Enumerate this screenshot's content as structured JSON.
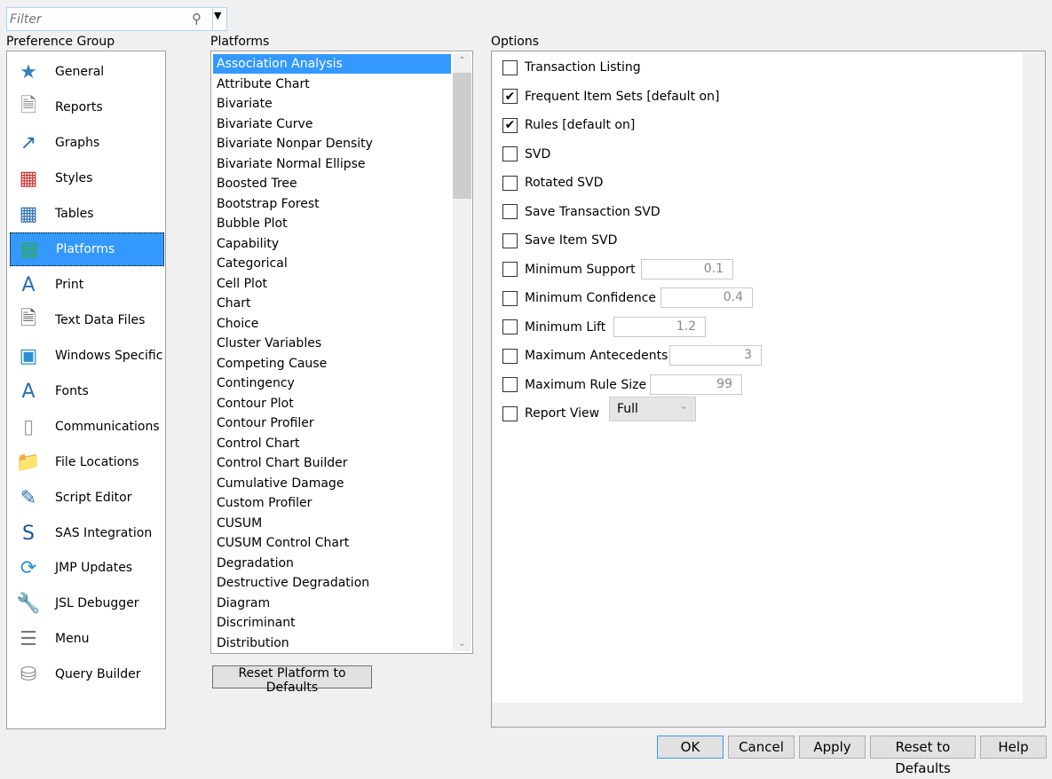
{
  "filter": {
    "placeholder": "Filter"
  },
  "labels": {
    "preference_group": "Preference Group",
    "platforms": "Platforms",
    "options": "Options"
  },
  "preference_groups": [
    {
      "label": "General",
      "icon": "general-icon"
    },
    {
      "label": "Reports",
      "icon": "reports-icon"
    },
    {
      "label": "Graphs",
      "icon": "graphs-icon"
    },
    {
      "label": "Styles",
      "icon": "styles-icon"
    },
    {
      "label": "Tables",
      "icon": "tables-icon"
    },
    {
      "label": "Platforms",
      "icon": "platforms-icon",
      "selected": true
    },
    {
      "label": "Print",
      "icon": "print-icon"
    },
    {
      "label": "Text Data Files",
      "icon": "text-file-icon"
    },
    {
      "label": "Windows Specific",
      "icon": "monitor-icon"
    },
    {
      "label": "Fonts",
      "icon": "fonts-icon"
    },
    {
      "label": "Communications",
      "icon": "communications-icon"
    },
    {
      "label": "File Locations",
      "icon": "folder-icon"
    },
    {
      "label": "Script Editor",
      "icon": "script-editor-icon"
    },
    {
      "label": "SAS Integration",
      "icon": "sas-icon"
    },
    {
      "label": "JMP Updates",
      "icon": "updates-icon"
    },
    {
      "label": "JSL Debugger",
      "icon": "wrench-icon"
    },
    {
      "label": "Menu",
      "icon": "menu-icon"
    },
    {
      "label": "Query Builder",
      "icon": "database-icon"
    }
  ],
  "platforms": [
    "Association Analysis",
    "Attribute Chart",
    "Bivariate",
    "Bivariate Curve",
    "Bivariate Nonpar Density",
    "Bivariate Normal Ellipse",
    "Boosted Tree",
    "Bootstrap Forest",
    "Bubble Plot",
    "Capability",
    "Categorical",
    "Cell Plot",
    "Chart",
    "Choice",
    "Cluster Variables",
    "Competing Cause",
    "Contingency",
    "Contour Plot",
    "Contour Profiler",
    "Control Chart",
    "Control Chart Builder",
    "Cumulative Damage",
    "Custom Profiler",
    "CUSUM",
    "CUSUM Control Chart",
    "Degradation",
    "Destructive Degradation",
    "Diagram",
    "Discriminant",
    "Distribution"
  ],
  "reset_platform_label": "Reset Platform to Defaults",
  "options": [
    {
      "label": "Transaction Listing",
      "checked": false
    },
    {
      "label": "Frequent Item Sets [default on]",
      "checked": true
    },
    {
      "label": "Rules [default on]",
      "checked": true
    },
    {
      "label": "SVD",
      "checked": false
    },
    {
      "label": "Rotated SVD",
      "checked": false
    },
    {
      "label": "Save Transaction SVD",
      "checked": false
    },
    {
      "label": "Save Item SVD",
      "checked": false
    },
    {
      "label": "Minimum Support",
      "checked": false,
      "value": "0.1"
    },
    {
      "label": "Minimum Confidence",
      "checked": false,
      "value": "0.4"
    },
    {
      "label": "Minimum Lift",
      "checked": false,
      "value": "1.2"
    },
    {
      "label": "Maximum Antecedents",
      "checked": false,
      "value": "3"
    },
    {
      "label": "Maximum Rule Size",
      "checked": false,
      "value": "99"
    },
    {
      "label": "Report View",
      "checked": false,
      "select": "Full"
    }
  ],
  "buttons": {
    "ok": "OK",
    "cancel": "Cancel",
    "apply": "Apply",
    "reset": "Reset to Defaults",
    "help": "Help"
  },
  "colors": {
    "selection": "#3399ff"
  }
}
